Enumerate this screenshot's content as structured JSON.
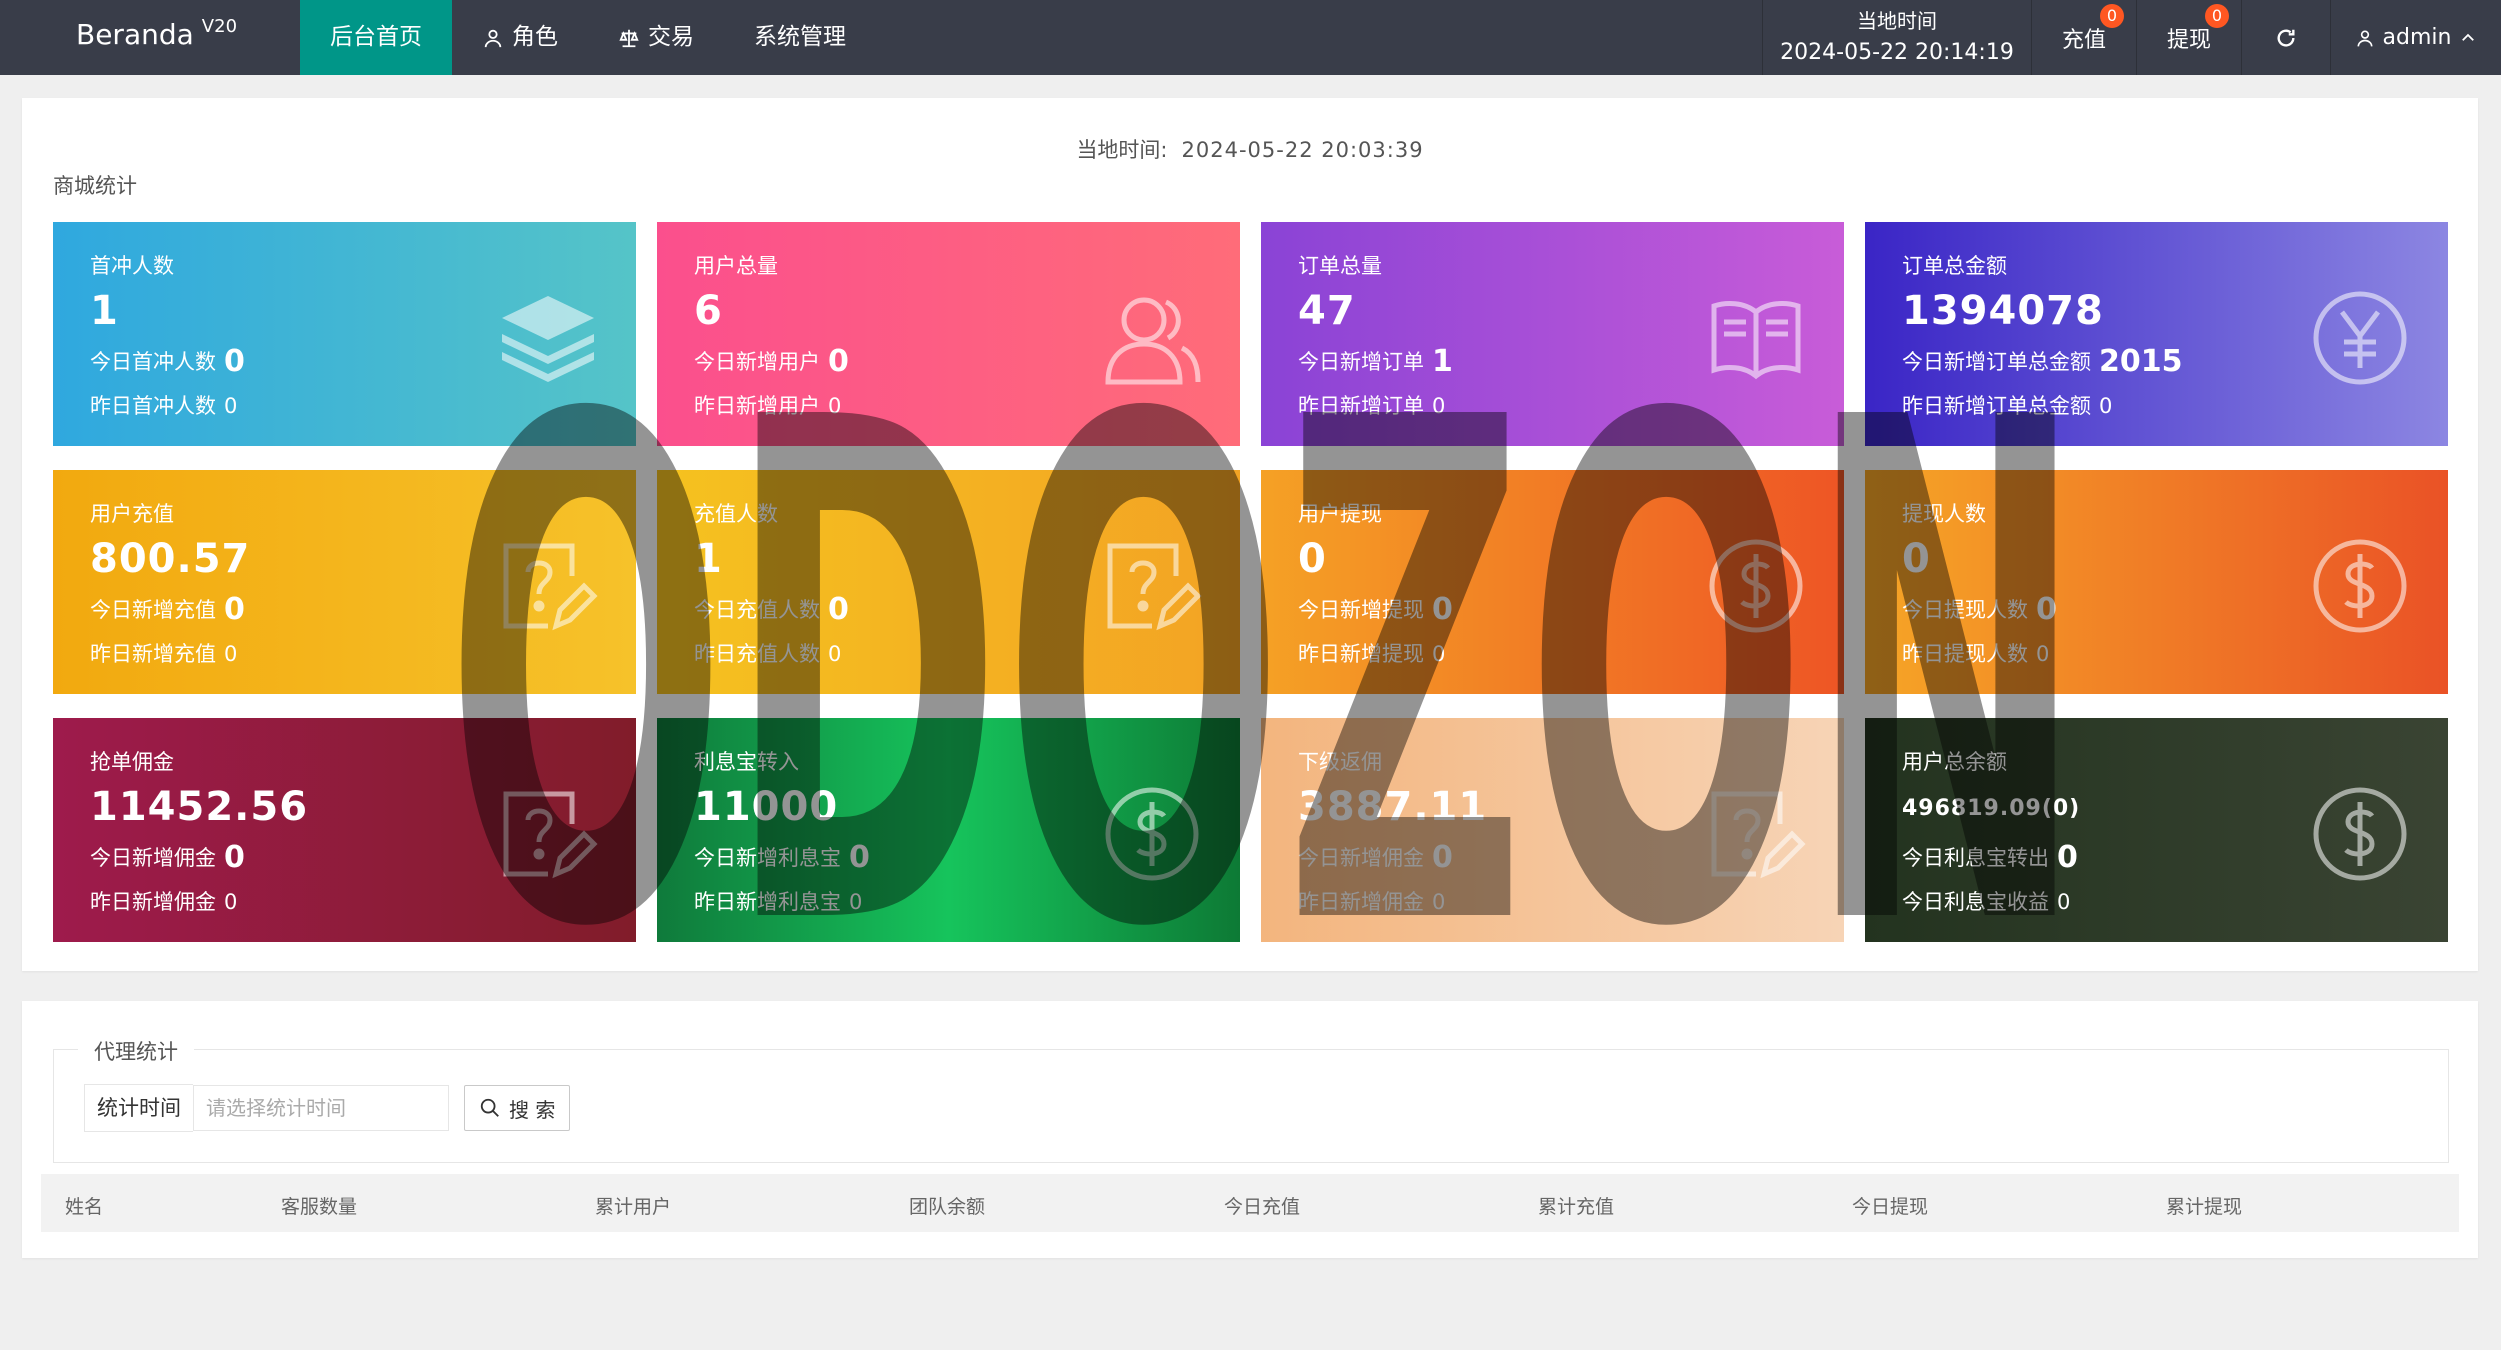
{
  "brand": {
    "name": "Beranda",
    "version": "V20"
  },
  "nav": [
    {
      "label": "后台首页",
      "icon": "",
      "active": true
    },
    {
      "label": "角色",
      "icon": "user-icon"
    },
    {
      "label": "交易",
      "icon": "scale-icon"
    },
    {
      "label": "系统管理",
      "icon": ""
    }
  ],
  "header": {
    "time_label": "当地时间",
    "time_value": "2024-05-22 20:14:19",
    "recharge_label": "充值",
    "recharge_badge": "0",
    "withdraw_label": "提现",
    "withdraw_badge": "0",
    "user_name": "admin"
  },
  "stats": {
    "local_time_label": "当地时间:",
    "local_time_value": "2024-05-22 20:03:39",
    "section_title": "商城统计",
    "cards": [
      {
        "title": "首冲人数",
        "value": "1",
        "today_label": "今日首冲人数",
        "today_value": "0",
        "yesterday_label": "昨日首冲人数",
        "yesterday_value": "0",
        "icon": "layers-icon"
      },
      {
        "title": "用户总量",
        "value": "6",
        "today_label": "今日新增用户",
        "today_value": "0",
        "yesterday_label": "昨日新增用户",
        "yesterday_value": "0",
        "icon": "users-icon"
      },
      {
        "title": "订单总量",
        "value": "47",
        "today_label": "今日新增订单",
        "today_value": "1",
        "yesterday_label": "昨日新增订单",
        "yesterday_value": "0",
        "icon": "book-icon"
      },
      {
        "title": "订单总金额",
        "value": "1394078",
        "today_label": "今日新增订单总金额",
        "today_value": "2015",
        "yesterday_label": "昨日新增订单总金额",
        "yesterday_value": "0",
        "icon": "yen-icon"
      },
      {
        "title": "用户充值",
        "value": "800.57",
        "today_label": "今日新增充值",
        "today_value": "0",
        "yesterday_label": "昨日新增充值",
        "yesterday_value": "0",
        "icon": "question-edit-icon"
      },
      {
        "title": "充值人数",
        "value": "1",
        "today_label": "今日充值人数",
        "today_value": "0",
        "yesterday_label": "昨日充值人数",
        "yesterday_value": "0",
        "icon": "question-edit-icon"
      },
      {
        "title": "用户提现",
        "value": "0",
        "today_label": "今日新增提现",
        "today_value": "0",
        "yesterday_label": "昨日新增提现",
        "yesterday_value": "0",
        "icon": "dollar-icon"
      },
      {
        "title": "提现人数",
        "value": "0",
        "today_label": "今日提现人数",
        "today_value": "0",
        "yesterday_label": "昨日提现人数",
        "yesterday_value": "0",
        "icon": "dollar-icon"
      },
      {
        "title": "抢单佣金",
        "value": "11452.56",
        "today_label": "今日新增佣金",
        "today_value": "0",
        "yesterday_label": "昨日新增佣金",
        "yesterday_value": "0",
        "icon": "question-edit-icon"
      },
      {
        "title": "利息宝转入",
        "value": "11000",
        "today_label": "今日新增利息宝",
        "today_value": "0",
        "yesterday_label": "昨日新增利息宝",
        "yesterday_value": "0",
        "icon": "dollar-icon"
      },
      {
        "title": "下级返佣",
        "value": "3887.11",
        "today_label": "今日新增佣金",
        "today_value": "0",
        "yesterday_label": "昨日新增佣金",
        "yesterday_value": "0",
        "icon": "question-edit-icon"
      },
      {
        "title": "用户总余额",
        "value": "496819.09(0)",
        "today_label": "今日利息宝转出",
        "today_value": "0",
        "yesterday_label": "今日利息宝收益",
        "yesterday_value": "0",
        "icon": "dollar-icon"
      }
    ]
  },
  "watermark": "ODOZON",
  "agent": {
    "legend": "代理统计",
    "time_label": "统计时间",
    "time_placeholder": "请选择统计时间",
    "search_label": "搜 索",
    "columns": [
      "姓名",
      "客服数量",
      "累计用户",
      "团队余额",
      "今日充值",
      "累计充值",
      "今日提现",
      "累计提现"
    ]
  }
}
